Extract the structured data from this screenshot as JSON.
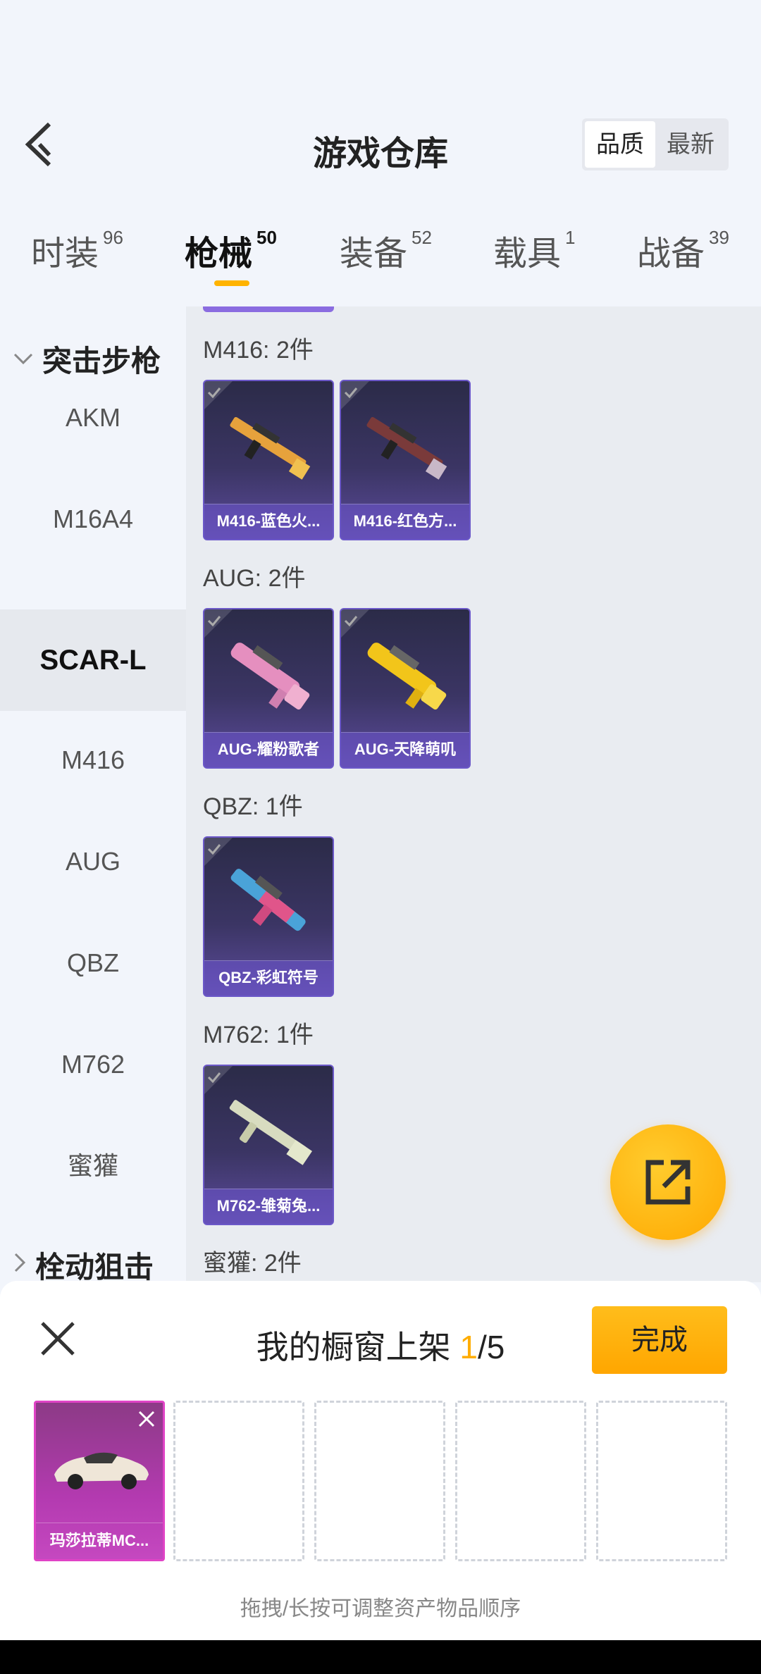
{
  "header": {
    "title": "游戏仓库",
    "sort": [
      "品质",
      "最新"
    ],
    "sort_active": 0
  },
  "tabs": [
    {
      "label": "时装",
      "count": "96"
    },
    {
      "label": "枪械",
      "count": "50"
    },
    {
      "label": "装备",
      "count": "52"
    },
    {
      "label": "载具",
      "count": "1"
    },
    {
      "label": "战备",
      "count": "39"
    }
  ],
  "sidebar": {
    "group1": "突击步枪",
    "items": [
      "AKM",
      "M16A4",
      "SCAR-L",
      "M416",
      "AUG",
      "QBZ",
      "M762",
      "蜜獾"
    ],
    "active": "SCAR-L",
    "group2": "栓动狙击"
  },
  "sections": [
    {
      "title": "M416: 2件",
      "cards": [
        "M416-蓝色火...",
        "M416-红色方..."
      ]
    },
    {
      "title": "AUG: 2件",
      "cards": [
        "AUG-耀粉歌者",
        "AUG-天降萌叽"
      ]
    },
    {
      "title": "QBZ: 1件",
      "cards": [
        "QBZ-彩虹符号"
      ]
    },
    {
      "title": "M762: 1件",
      "cards": [
        "M762-雏菊兔..."
      ]
    },
    {
      "title": "蜜獾: 2件",
      "cards": []
    }
  ],
  "panel": {
    "title_prefix": "我的橱窗上架 ",
    "count_current": "1",
    "count_total": "/5",
    "done_label": "完成",
    "filled_slot_label": "玛莎拉蒂MC...",
    "hint": "拖拽/长按可调整资产物品顺序"
  },
  "colors": {
    "accent": "#ffad00",
    "card_purple": "#6b58c8",
    "slot_pink": "#e043c6"
  },
  "icons": {
    "back": "chevron-left-icon",
    "fab": "share-external-icon",
    "close": "close-icon"
  }
}
